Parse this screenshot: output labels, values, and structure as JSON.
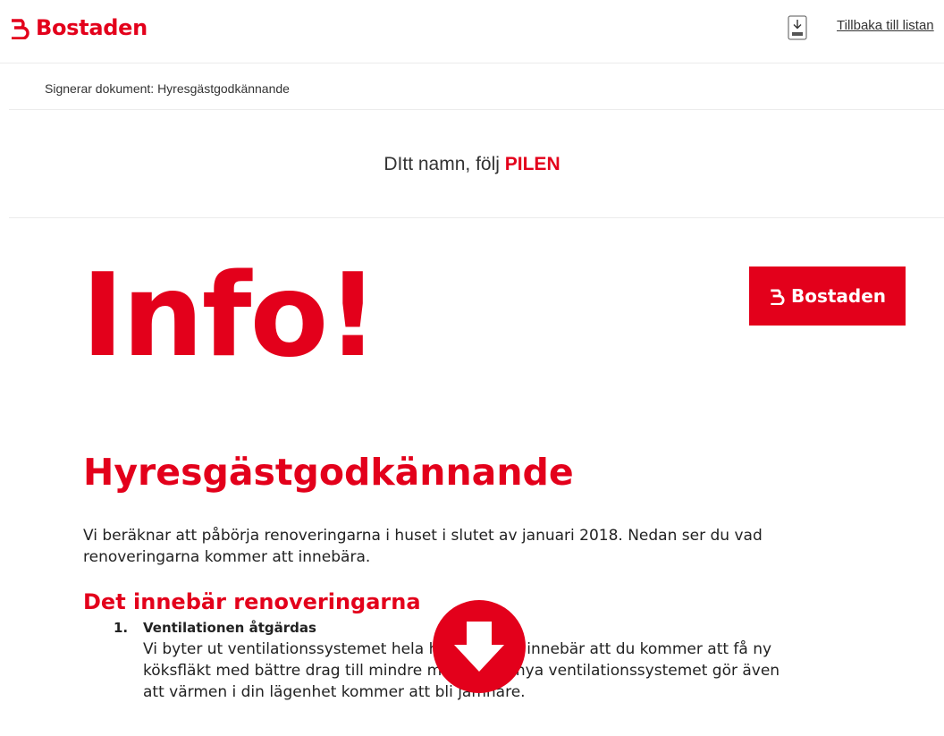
{
  "header": {
    "brand": "Bostaden",
    "back_link": "Tillbaka till listan",
    "pdf_icon": "download-pdf-icon"
  },
  "subheader": {
    "text": "Signerar dokument: Hyresgästgodkännande"
  },
  "instruction": {
    "prefix": "DItt namn, följ ",
    "highlight": "PILEN"
  },
  "document": {
    "badge_text": "Bostaden",
    "info_title": "Info!",
    "title": "Hyresgästgodkännande",
    "intro": "Vi beräknar att påbörja renoveringarna i huset i slutet av januari 2018. Nedan ser du vad renoveringarna kommer att innebära.",
    "section_title": "Det innebär renoveringarna",
    "items": [
      {
        "number": "1.",
        "title": "Ventilationen åtgärdas",
        "text": "Vi byter ut ventilationssystemet hela huset, vilket innebär att du kommer att få ny köksfläkt med bättre drag till mindre matos. Det nya ventilationssystemet gör även att värmen i din lägenhet kommer att bli jämnare."
      }
    ]
  },
  "colors": {
    "brand_red": "#e3001b",
    "text": "#222222",
    "divider": "#ececec"
  },
  "icons": {
    "logo": "bostaden-logo-icon",
    "arrow": "arrow-down-icon"
  }
}
